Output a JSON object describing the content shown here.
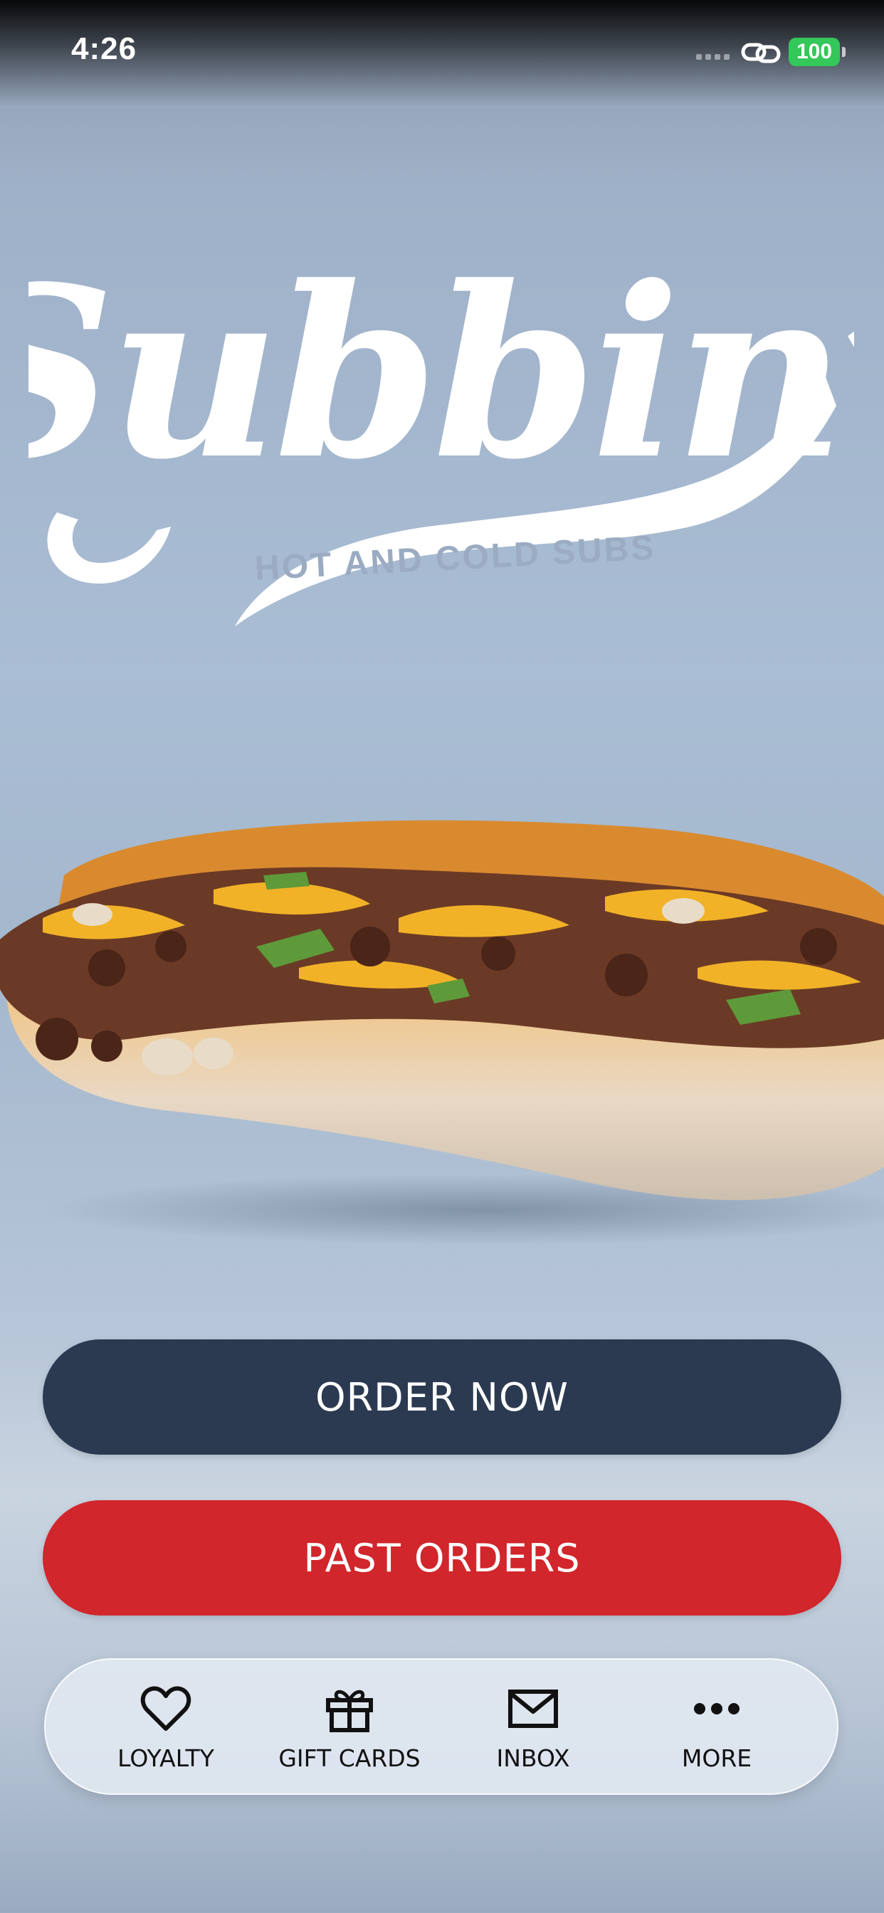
{
  "status_bar": {
    "time": "4:26",
    "battery": "100"
  },
  "logo": {
    "wordmark": "Subbin'",
    "tagline": "HOT AND COLD SUBS"
  },
  "actions": {
    "order_now": "ORDER NOW",
    "past_orders": "PAST ORDERS"
  },
  "nav": {
    "items": [
      {
        "label": "LOYALTY",
        "icon": "heart-icon"
      },
      {
        "label": "GIFT CARDS",
        "icon": "gift-icon"
      },
      {
        "label": "INBOX",
        "icon": "mail-icon"
      },
      {
        "label": "MORE",
        "icon": "more-dots-icon"
      }
    ]
  },
  "colors": {
    "order_now_bg": "#2b3a51",
    "past_orders_bg": "#d1262b",
    "battery_green": "#34c759"
  }
}
